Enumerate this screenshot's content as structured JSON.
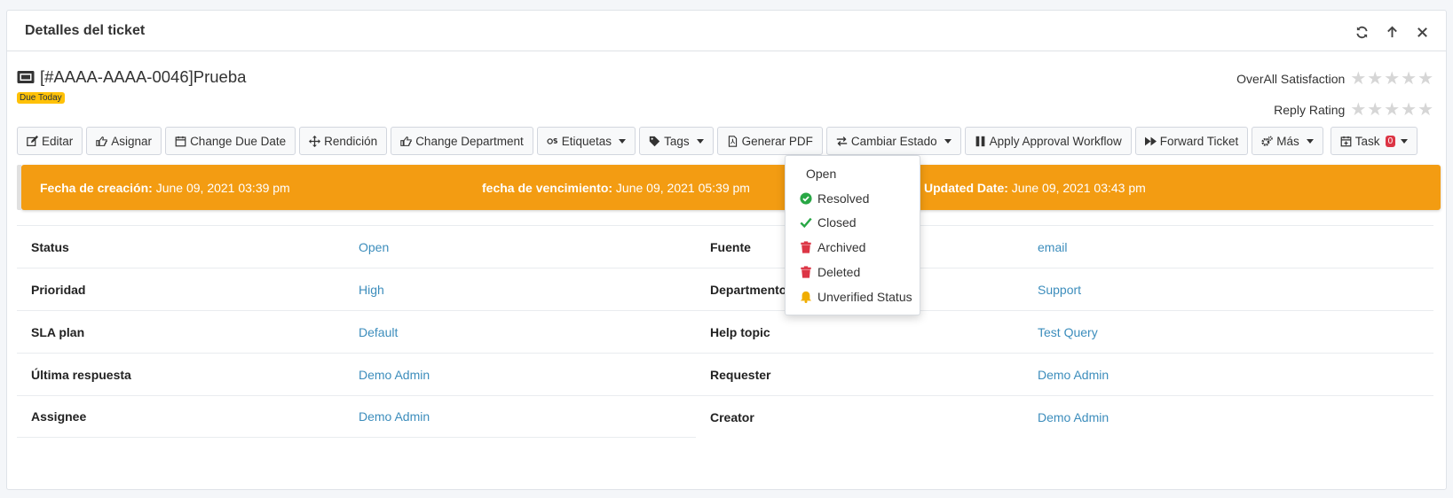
{
  "card": {
    "title": "Detalles del ticket",
    "tools": [
      "refresh-icon",
      "arrow-up-icon",
      "close-icon"
    ]
  },
  "ticket": {
    "title": "[#AAAA-AAAA-0046]Prueba",
    "badge": "Due Today",
    "overall_label": "OverAll Satisfaction",
    "reply_label": "Reply Rating",
    "overall_stars": 0,
    "reply_stars": 0
  },
  "toolbar": {
    "edit": "Editar",
    "assign": "Asignar",
    "due_date": "Change Due Date",
    "surrender": "Rendición",
    "department": "Change Department",
    "labels": "Etiquetas",
    "tags": "Tags",
    "pdf": "Generar PDF",
    "status": "Cambiar Estado",
    "approval": "Apply Approval Workflow",
    "forward": "Forward Ticket",
    "more": "Más",
    "task": "Task",
    "task_count": "0"
  },
  "dates": {
    "created_label": "Fecha de creación:",
    "created_value": " June 09, 2021 03:39 pm",
    "due_label": "fecha de vencimiento:",
    "due_value": " June 09, 2021 05:39 pm",
    "updated_label": "Updated Date:",
    "updated_value": " June 09, 2021 03:43 pm",
    "banner_color": "#f39c12"
  },
  "left_rows": [
    {
      "label": "Status",
      "value": "Open"
    },
    {
      "label": "Prioridad",
      "value": "High"
    },
    {
      "label": "SLA plan",
      "value": "Default"
    },
    {
      "label": "Última respuesta",
      "value": "Demo Admin"
    },
    {
      "label": "Assignee",
      "value": "Demo Admin"
    }
  ],
  "right_rows": [
    {
      "label": "Fuente",
      "value": "email"
    },
    {
      "label": "Departmentos",
      "value": "Support"
    },
    {
      "label": "Help topic",
      "value": "Test Query"
    },
    {
      "label": "Requester",
      "value": "Demo Admin"
    },
    {
      "label": "Creator",
      "value": "Demo Admin"
    }
  ],
  "status_menu": [
    {
      "label": "Open",
      "icon": ""
    },
    {
      "label": "Resolved",
      "icon": "check-circle-icon",
      "color": "#28a745"
    },
    {
      "label": "Closed",
      "icon": "check-icon",
      "color": "#28a745"
    },
    {
      "label": "Archived",
      "icon": "trash-icon",
      "color": "#dc3545"
    },
    {
      "label": "Deleted",
      "icon": "trash-icon",
      "color": "#dc3545"
    },
    {
      "label": "Unverified Status",
      "icon": "bell-icon",
      "color": "#f0ad00"
    }
  ],
  "colors": {
    "link": "#3c8dbc",
    "badge": "#ffc107"
  }
}
